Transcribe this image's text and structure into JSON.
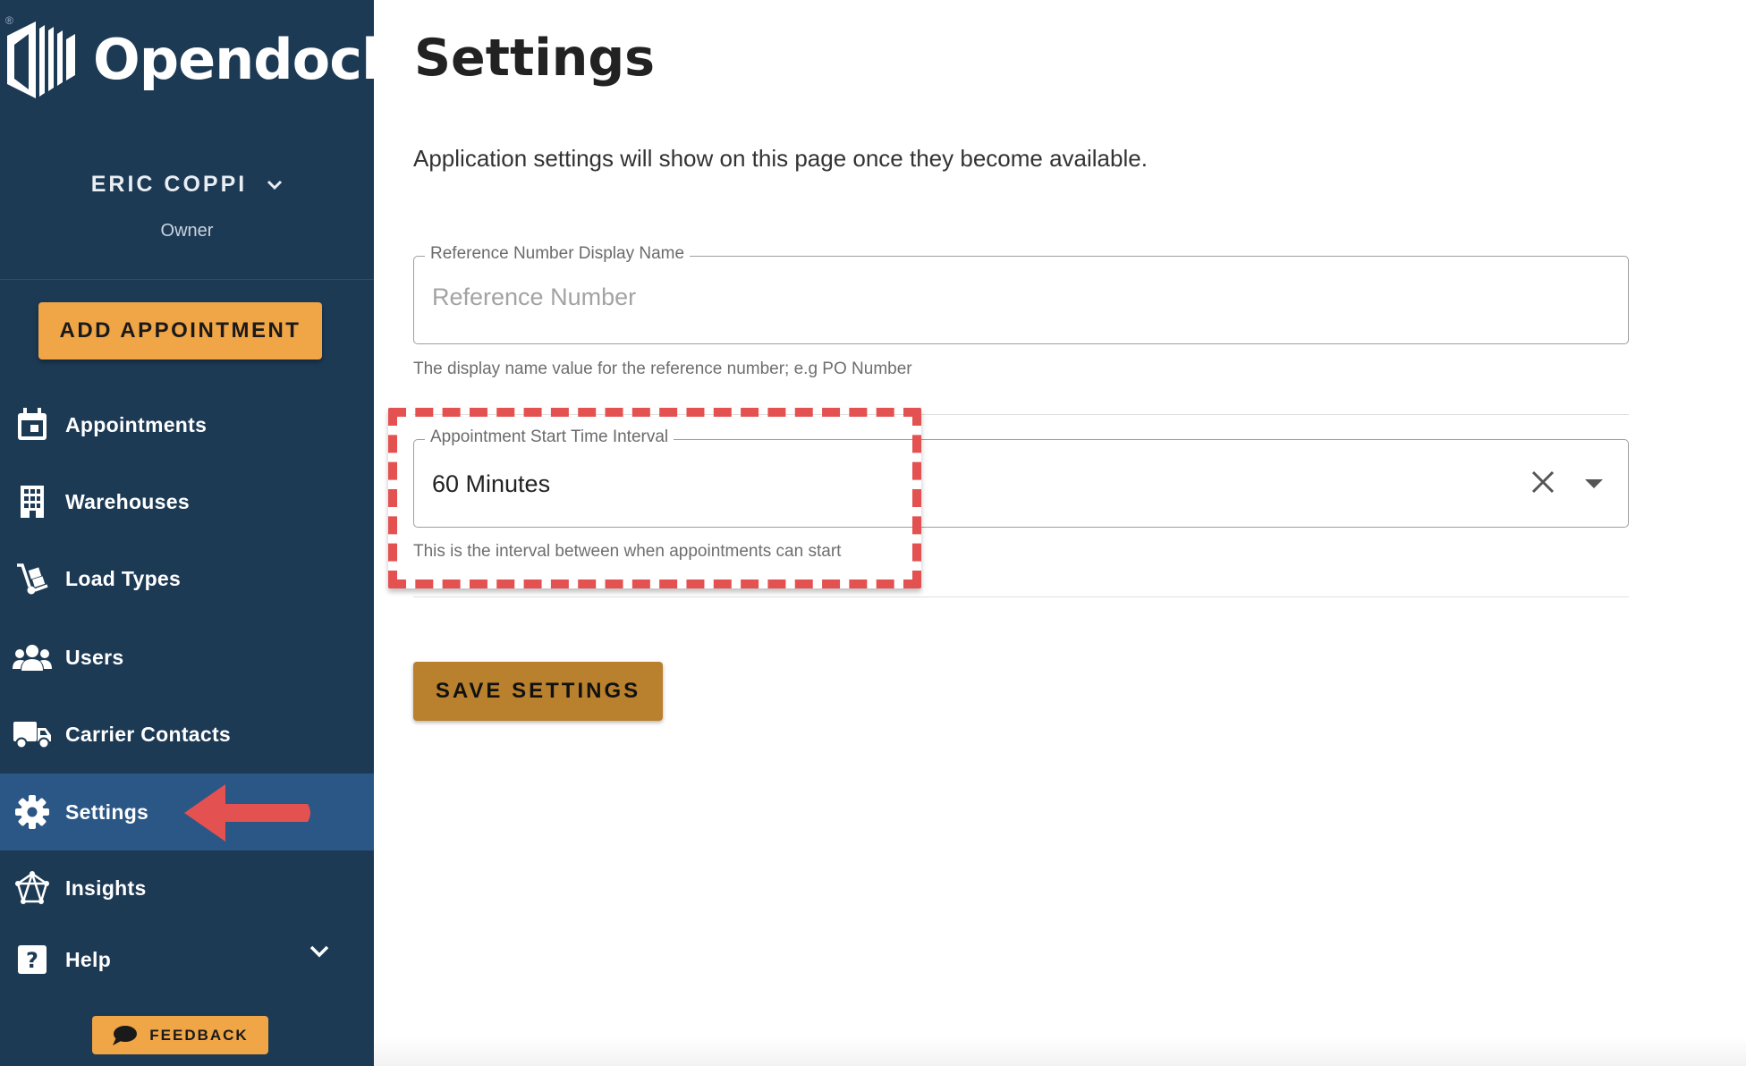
{
  "brand": {
    "name": "Opendock",
    "reg_mark": "®"
  },
  "user": {
    "name": "ERIC COPPI",
    "role": "Owner"
  },
  "sidebar": {
    "add_button": "ADD APPOINTMENT",
    "items": [
      {
        "label": "Appointments",
        "icon": "calendar-icon"
      },
      {
        "label": "Warehouses",
        "icon": "building-icon"
      },
      {
        "label": "Load Types",
        "icon": "hand-truck-icon"
      },
      {
        "label": "Users",
        "icon": "users-icon"
      },
      {
        "label": "Carrier Contacts",
        "icon": "truck-icon"
      },
      {
        "label": "Settings",
        "icon": "gear-icon",
        "active": true
      },
      {
        "label": "Insights",
        "icon": "insights-icon"
      },
      {
        "label": "Help",
        "icon": "help-icon"
      }
    ],
    "feedback": "FEEDBACK"
  },
  "main": {
    "title": "Settings",
    "intro": "Application settings will show on this page once they become available.",
    "reference_field": {
      "legend": "Reference Number Display Name",
      "placeholder": "Reference Number",
      "hint": "The display name value for the reference number; e.g PO Number"
    },
    "interval_field": {
      "legend": "Appointment Start Time Interval",
      "value": "60 Minutes",
      "hint": "This is the interval between when appointments can start"
    },
    "save_button": "SAVE SETTINGS"
  },
  "colors": {
    "sidebar_bg": "#1d3a55",
    "active_item_bg": "#2b5786",
    "accent_orange": "#f0a546",
    "save_button": "#b9812e",
    "annotation_red": "#e45151"
  }
}
